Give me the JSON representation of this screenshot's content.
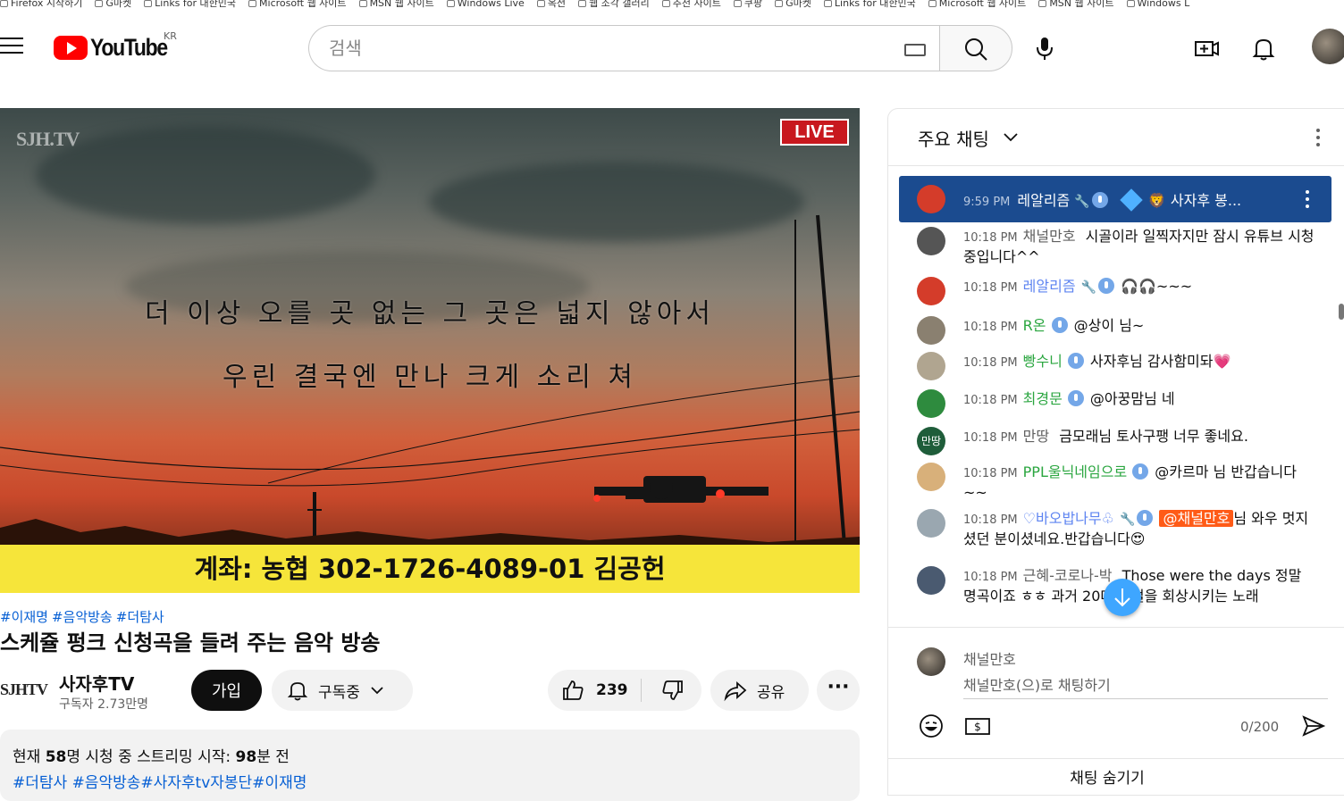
{
  "bookmarks": [
    "Firefox 시작하기",
    "G마켓",
    "Links for 대한민국",
    "Microsoft 웹 사이트",
    "MSN 웹 사이트",
    "Windows Live",
    "옥션",
    "웹 조각 갤러리",
    "추천 사이트",
    "쿠팡",
    "G마켓",
    "Links for 대한민국",
    "Microsoft 웹 사이트",
    "MSN 웹 사이트",
    "Windows L"
  ],
  "header": {
    "logo_text": "YouTube",
    "region": "KR",
    "search_placeholder": "검색"
  },
  "player": {
    "live_label": "LIVE",
    "watermark": "SJH.TV",
    "lyric_line1": "더 이상 오를 곳 없는 그 곳은 넓지 않아서",
    "lyric_line2": "우린 결국엔 만나 크게 소리 쳐",
    "account_text": "계좌: 농협 302-1726-4089-01 김공헌"
  },
  "video": {
    "tags": [
      "#이재명",
      "#음악방송",
      "#더탐사"
    ],
    "title": "스케쥴 펑크 신청곡을 들려 주는 음악 방송",
    "channel_logo": "SJHTV",
    "channel_name": "사자후TV",
    "subscribers": "구독자 2.73만명",
    "join_label": "가입",
    "subscribed_label": "구독중",
    "likes": "239",
    "share_label": "공유",
    "more_label": "···",
    "desc_prefix": "현재",
    "desc_viewers": "58",
    "desc_viewers_suffix": "명 시청 중  스트리밍 시작:",
    "desc_started": "98",
    "desc_started_suffix": "분 전",
    "desc_tags": "#더탐사 #음악방송#사자후tv자봉단#이재명"
  },
  "chat": {
    "title": "주요 채팅",
    "pinned": {
      "time": "9:59 PM",
      "author": "레알리즘",
      "text": "🦁 사자후 봉..."
    },
    "messages": [
      {
        "time": "10:18 PM",
        "author": "채널만호",
        "text": "시골이라 일찍자지만 잠시 유튜브 시청중입니다^^",
        "style": "",
        "av": "#555"
      },
      {
        "time": "10:18 PM",
        "author": "레알리즘",
        "text": "🎧🎧~~~",
        "style": "blue",
        "av": "#d43c2a"
      },
      {
        "time": "10:18 PM",
        "author": "R온",
        "text": "@상이 님~",
        "style": "mod",
        "av": "#8a8070"
      },
      {
        "time": "10:18 PM",
        "author": "빵수니",
        "text": "사자후님 감사함미돠💗",
        "style": "mod",
        "av": "#b0a590"
      },
      {
        "time": "10:18 PM",
        "author": "최경문",
        "text": "@아꿍맘님 네",
        "style": "mod",
        "av": "#2e8b3e"
      },
      {
        "time": "10:18 PM",
        "author": "만땅",
        "text": "금모래님 토사구팽 너무 좋네요.",
        "style": "",
        "av": "#1f5d3a"
      },
      {
        "time": "10:18 PM",
        "author": "PPL울닉네임으로",
        "text": "@카르마 님 반갑습니다~~",
        "style": "mod",
        "av": "#d8b07a"
      },
      {
        "time": "10:18 PM",
        "author": "♡바오밥나무♧",
        "mention": "@채널만호",
        "text": "님 와우 멋지셨던 분이셨네요.반갑습니다😍",
        "style": "blue",
        "av": "#9aa7b0"
      },
      {
        "time": "10:18 PM",
        "author": "근혜-코로나-박",
        "text": "Those were the days 정말 명곡이죠 ㅎㅎ 과거 20대 시절을 회상시키는 노래",
        "style": "",
        "av": "#4a5a70"
      }
    ],
    "manttang_avatar": "만땅",
    "input_name": "채널만호",
    "input_placeholder": "채널만호(으)로 채팅하기",
    "char_count": "0/200",
    "hide_label": "채팅 숨기기"
  },
  "colors": {
    "brand": "#ff0000",
    "link": "#065fd4",
    "pinned_bg": "#1b4b8f",
    "live": "#c8181e",
    "mention": "#ff5b17"
  }
}
